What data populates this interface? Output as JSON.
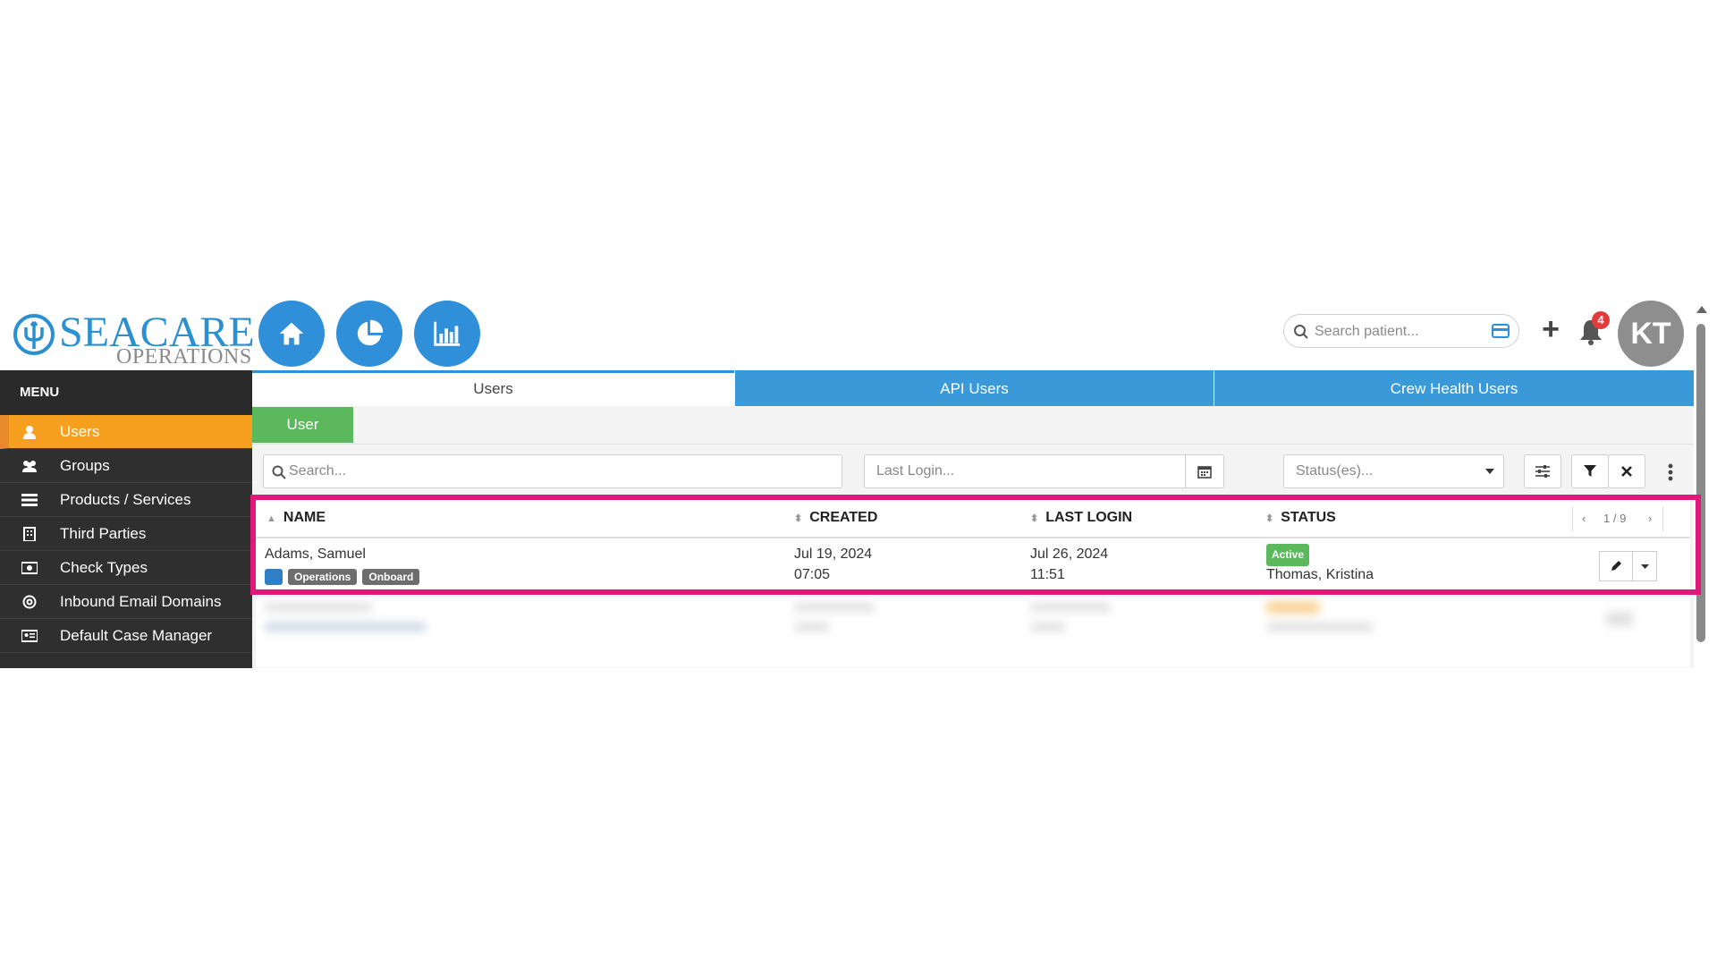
{
  "brand": {
    "word_main": "SEACARE",
    "word_sub": "OPERATIONS"
  },
  "header": {
    "nav_icons": [
      "home-icon",
      "pie-chart-icon",
      "bar-chart-icon"
    ],
    "search_placeholder": "Search patient...",
    "notification_count": "4",
    "avatar_initials": "KT"
  },
  "sidebar": {
    "title": "MENU",
    "items": [
      {
        "label": "Users",
        "icon": "user-icon",
        "active": true
      },
      {
        "label": "Groups",
        "icon": "users-icon"
      },
      {
        "label": "Products / Services",
        "icon": "list-icon"
      },
      {
        "label": "Third Parties",
        "icon": "building-icon"
      },
      {
        "label": "Check Types",
        "icon": "money-icon"
      },
      {
        "label": "Inbound Email Domains",
        "icon": "at-icon"
      },
      {
        "label": "Default Case Manager",
        "icon": "id-card-icon"
      }
    ]
  },
  "tabs": [
    "Users",
    "API Users",
    "Crew Health Users"
  ],
  "subtab": "User",
  "filters": {
    "search_placeholder": "Search...",
    "last_login_placeholder": "Last Login...",
    "status_placeholder": "Status(es)..."
  },
  "table": {
    "columns": [
      "NAME",
      "CREATED",
      "LAST LOGIN",
      "STATUS"
    ],
    "pager": "1 / 9",
    "rows": [
      {
        "name": "Adams, Samuel",
        "tags": [
          "Operations",
          "Onboard"
        ],
        "created_date": "Jul 19, 2024",
        "created_time": "07:05",
        "last_login_date": "Jul 26, 2024",
        "last_login_time": "11:51",
        "status": "Active",
        "manager": "Thomas, Kristina"
      }
    ]
  },
  "colors": {
    "accent_blue": "#2f8fd8",
    "active_orange": "#f7a020",
    "green": "#5cb85c",
    "highlight_pink": "#e0187a"
  }
}
